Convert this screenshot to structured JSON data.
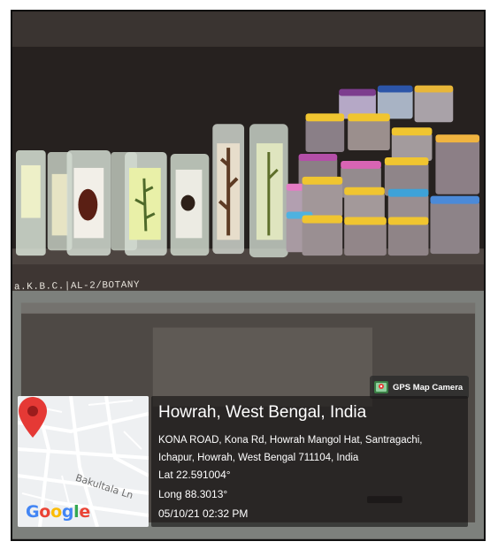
{
  "shelf_label": "a.K.B.C.|AL-2/BOTANY",
  "badge": {
    "icon": "gps-map-camera-icon",
    "label": "GPS Map Camera"
  },
  "map": {
    "street": "Bakultala Ln",
    "logo": "Google"
  },
  "location": {
    "title": "Howrah, West Bengal, India",
    "address_line1": "KONA ROAD, Kona Rd, Howrah Mangol Hat, Santragachi,",
    "address_line2": "Ichapur, Howrah, West Bengal 711104, India",
    "lat": "Lat 22.591004°",
    "long": "Long 88.3013°",
    "timestamp": "05/10/21 02:32 PM"
  },
  "colors": {
    "google_blue": "#4285F4",
    "google_red": "#EA4335",
    "google_yellow": "#FBBC05",
    "google_green": "#34A853",
    "pin": "#e53935"
  }
}
